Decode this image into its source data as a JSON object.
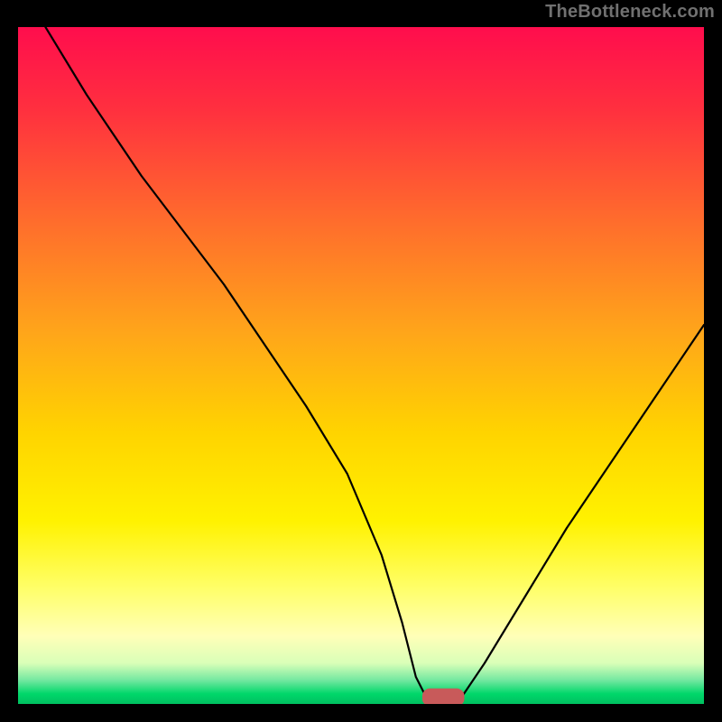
{
  "attribution": "TheBottleneck.com",
  "colors": {
    "curve": "#000000",
    "marker_fill": "#c85a5a",
    "marker_stroke": "#c85a5a",
    "attribution_text": "#707070",
    "gradient_stops": [
      {
        "offset": 0.0,
        "color": "#ff0d4d"
      },
      {
        "offset": 0.12,
        "color": "#ff2f3f"
      },
      {
        "offset": 0.28,
        "color": "#ff6a2d"
      },
      {
        "offset": 0.45,
        "color": "#ffa51a"
      },
      {
        "offset": 0.6,
        "color": "#ffd400"
      },
      {
        "offset": 0.73,
        "color": "#fff200"
      },
      {
        "offset": 0.83,
        "color": "#ffff6a"
      },
      {
        "offset": 0.9,
        "color": "#ffffb8"
      },
      {
        "offset": 0.94,
        "color": "#d9ffb8"
      },
      {
        "offset": 0.965,
        "color": "#73e8a0"
      },
      {
        "offset": 0.985,
        "color": "#00d76a"
      },
      {
        "offset": 1.0,
        "color": "#00c060"
      }
    ]
  },
  "chart_data": {
    "type": "line",
    "title": "",
    "xlabel": "",
    "ylabel": "",
    "xlim": [
      0,
      100
    ],
    "ylim": [
      0,
      100
    ],
    "x": [
      4,
      10,
      18,
      24,
      30,
      36,
      42,
      48,
      53,
      56,
      58,
      60,
      62,
      64,
      68,
      74,
      80,
      86,
      92,
      100
    ],
    "values": [
      100,
      90,
      78,
      70,
      62,
      53,
      44,
      34,
      22,
      12,
      4,
      0,
      0,
      0,
      6,
      16,
      26,
      35,
      44,
      56
    ],
    "marker": {
      "x_center": 62,
      "y": 0,
      "width": 6,
      "height": 2.5
    },
    "series": [
      {
        "name": "bottleneck-curve",
        "values": [
          100,
          90,
          78,
          70,
          62,
          53,
          44,
          34,
          22,
          12,
          4,
          0,
          0,
          0,
          6,
          16,
          26,
          35,
          44,
          56
        ]
      }
    ]
  }
}
